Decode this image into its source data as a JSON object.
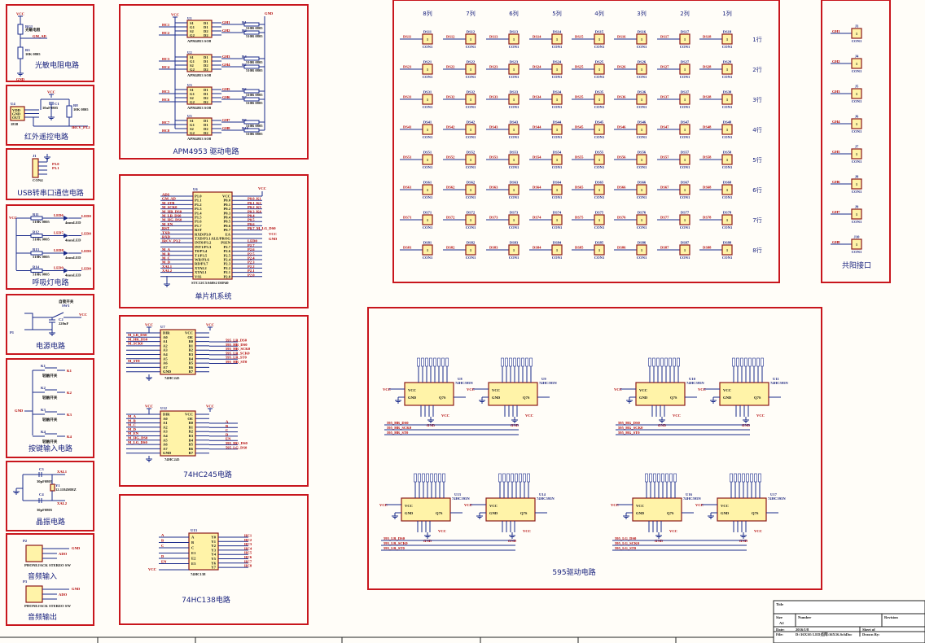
{
  "colors": {
    "panel": "#c8161d",
    "wire": "#1a2a8a",
    "chip_fill": "#fff3a8",
    "chip_border": "#8b1a1a",
    "net_label": "#b00000"
  },
  "sections": {
    "photo": "光敏电阻电路",
    "ir": "红外遥控电路",
    "usb": "USB转串口通信电路",
    "breath": "呼吸灯电路",
    "power": "电源电路",
    "keys": "按键输入电路",
    "crystal": "晶振电路",
    "audio_in": "音频输入",
    "audio_out": "音频输出",
    "apm": "APM4953 驱动电路",
    "mcu": "单片机系统",
    "hc245": "74HC245电路",
    "hc138": "74HC138电路",
    "matrix": "",
    "anode": "共阳接口",
    "hc595": "595驱动电路"
  },
  "photo": {
    "vcc": "VCC",
    "rg": "RG1",
    "rg_desc": "光敏电阻",
    "net": "GM_AD",
    "r": "R3",
    "r_val": "10K 0805",
    "gnd": "GND"
  },
  "ir": {
    "vcc": "VCC",
    "u": "U4",
    "pins": [
      "VDD",
      "GND",
      "OUT"
    ],
    "part": "1838",
    "c": "C1",
    "c_val": "10uF0805",
    "r": "R8",
    "r_val": "10K 0805",
    "net": "IRCV_P3.2"
  },
  "usb": {
    "j": "J1",
    "nets": [
      "P3.0",
      "P3.1"
    ],
    "gnd": "GND",
    "part": "CON4"
  },
  "breath": {
    "vcc": "VCC",
    "rows": [
      {
        "r": "R11",
        "val": "510K 0805",
        "led": "LED6",
        "net": "LED0",
        "type": "4mmLED"
      },
      {
        "r": "R12",
        "val": "510K 0805",
        "led": "LED7",
        "net": "LED0",
        "type": "4mmLED"
      },
      {
        "r": "R13",
        "val": "510K 0805",
        "led": "LED8",
        "net": "LED0",
        "type": "4mmLED"
      },
      {
        "r": "R14",
        "val": "510K 0805",
        "led": "LED9",
        "net": "LED0",
        "type": "4mmLED"
      }
    ]
  },
  "power": {
    "p": "P1",
    "sw": "SW1",
    "sw_desc": "自锁开关",
    "c": "C2",
    "c_val": "220uF",
    "vcc": "VCC"
  },
  "keys": {
    "gnd": "GND",
    "items": [
      {
        "k": "K1",
        "desc": "轻触开关",
        "net": "K1"
      },
      {
        "k": "K2",
        "desc": "轻触开关",
        "net": "K2"
      },
      {
        "k": "K3",
        "desc": "轻触开关",
        "net": "K3"
      },
      {
        "k": "K4",
        "desc": "轻触开关",
        "net": "K4"
      }
    ]
  },
  "crystal": {
    "c3": "C3",
    "c3_val": "30pF0805",
    "c4": "C4",
    "c4_val": "30pF0805",
    "y": "Y1",
    "y_val": "12.1184MHZ",
    "n1": "XAL1",
    "n2": "XAL2"
  },
  "audio": {
    "p2": "P2",
    "p3": "P3",
    "part": "PHONEJACK STEREO SW",
    "net": "ADO",
    "gnd": "GND"
  },
  "apm": {
    "vcc": "VCC",
    "gnd": "GND",
    "part": "APM4953 SO8",
    "res_val": "510R 0805",
    "pins_l": [
      "S1",
      "G1",
      "S2",
      "G2"
    ],
    "pins_r": [
      "D1",
      "D1",
      "D2",
      "D2"
    ],
    "chips": [
      {
        "ref": "U1",
        "in": [
          "HC1",
          "HC2"
        ],
        "out": [
          "GH1",
          "GH2"
        ],
        "r": [
          "R1",
          "R2"
        ]
      },
      {
        "ref": "U2",
        "in": [
          "HC3",
          "HC4"
        ],
        "out": [
          "GH3",
          "GH4"
        ],
        "r": [
          "R4",
          "R5"
        ]
      },
      {
        "ref": "U3",
        "in": [
          "HC5",
          "HC6"
        ],
        "out": [
          "GH5",
          "GH6"
        ],
        "r": [
          "R6",
          "R7"
        ]
      },
      {
        "ref": "U5",
        "in": [
          "HC7",
          "HC8"
        ],
        "out": [
          "GH7",
          "GH8"
        ],
        "r": [
          "R9",
          "R10"
        ]
      }
    ]
  },
  "mcu": {
    "ref": "U6",
    "part": "STC12C5A60S2 DIP40",
    "vcc": "VCC",
    "gnd": "GND",
    "left_pins": [
      "P1.0",
      "P1.1",
      "P1.2",
      "P1.3",
      "P1.4",
      "P1.5",
      "P1.6",
      "P1.7",
      "RST",
      "RXD/P3.0",
      "TXD/P3.1",
      "INT0/P3.2",
      "INT1/P3.3",
      "T0/P3.4",
      "T1/P3.5",
      "WR/P3.6",
      "RD/P3.7",
      "XTAL2",
      "XTAL1",
      "VSS"
    ],
    "left_nets": [
      "ADS",
      "GM_AD",
      "M_STB",
      "M_SCK0",
      "M_HR_DS0",
      "M_LR_DS0",
      "M_HG_DS0",
      "M_EN",
      "RST",
      "TXD",
      "RXD",
      "IRCV_P3.2",
      "",
      "M_A",
      "M_B",
      "M_C",
      "M_D",
      "XAL1",
      "XAL2",
      ""
    ],
    "right_pins": [
      "VCC",
      "P0.0",
      "P0.1",
      "P0.2",
      "P0.3",
      "P0.4",
      "P0.5",
      "P0.6",
      "P0.7",
      "EA",
      "ALE/PROG",
      "PSEN",
      "P2.7",
      "P2.6",
      "P2.5",
      "P2.4",
      "P2.3",
      "P2.2",
      "P2.1",
      "P2.0"
    ],
    "right_nets": [
      "",
      "P0.0_K1",
      "P0.1_K2",
      "P0.2_K3",
      "P0.3_K4",
      "P0.4",
      "P0.5",
      "P0.6",
      "P0.7_M_LG_DS0",
      "",
      "",
      "LED0",
      "P2.7",
      "P2.6",
      "P2.5",
      "P2.4",
      "P2.3",
      "P2.2",
      "P2.1",
      "P2.0"
    ]
  },
  "hc245": {
    "part": "74HC245",
    "vcc": "VCC",
    "chips": [
      {
        "ref": "U7",
        "left": [
          "DIR",
          "A0",
          "A1",
          "A2",
          "A3",
          "A4",
          "A5",
          "A6",
          "A7",
          "GND"
        ],
        "right": [
          "VCC",
          "OE",
          "B0",
          "B1",
          "B2",
          "B3",
          "B4",
          "B5",
          "B6",
          "B7"
        ],
        "in": [
          "M_LR_DS0",
          "M_HR_DS0",
          "M_SCK0",
          "",
          "",
          "",
          "M_ST0"
        ],
        "out": [
          "595_LR_DS0",
          "595_HR_DS0",
          "595_HR_SCK0",
          "595_LR_SCK0",
          "595_LR_ST0",
          "595_HR_ST0"
        ]
      },
      {
        "ref": "U12",
        "left": [
          "DIR",
          "A0",
          "A1",
          "A2",
          "A3",
          "A4",
          "A5",
          "A6",
          "A7",
          "GND"
        ],
        "right": [
          "VCC",
          "OE",
          "B0",
          "B1",
          "B2",
          "B3",
          "B4",
          "B5",
          "B6",
          "B7"
        ],
        "in": [
          "M_A",
          "M_B",
          "M_C",
          "M_D",
          "M_EN",
          "M_HG_DS0",
          "M_LG_DS0"
        ],
        "out": [
          "A",
          "B",
          "C",
          "D",
          "EN",
          "595_HG_DS0",
          "595_LG_DS0"
        ]
      }
    ]
  },
  "hc138": {
    "ref": "U13",
    "part": "74HC138",
    "vcc": "VCC",
    "left": [
      "A",
      "B",
      "C",
      "E1",
      "E2",
      "E3"
    ],
    "right": [
      "Y0",
      "Y1",
      "Y2",
      "Y3",
      "Y4",
      "Y5",
      "Y6",
      "Y7"
    ],
    "in": [
      "A",
      "B",
      "C",
      "D",
      "EN"
    ],
    "out": [
      "HC1",
      "HC2",
      "HC3",
      "HC4",
      "HC5",
      "HC6",
      "HC7",
      "HC8"
    ]
  },
  "matrix": {
    "columns": [
      "8列",
      "7列",
      "6列",
      "5列",
      "4列",
      "3列",
      "2列",
      "1列"
    ],
    "rows": [
      "1行",
      "2行",
      "3行",
      "4行",
      "5行",
      "6行",
      "7行",
      "8行"
    ],
    "pin": "1",
    "part": "CON1",
    "prefix": "DS"
  },
  "anode": {
    "nets": [
      "GH1",
      "GH2",
      "GH3",
      "GH4",
      "GH5",
      "GH6",
      "GH7",
      "GH8"
    ],
    "refs": [
      "J3",
      "J4",
      "J5",
      "J6",
      "J7",
      "J8",
      "J9",
      "J10"
    ],
    "pin": "1",
    "part": "CON1"
  },
  "hc595": {
    "part": "74HC595N",
    "vcc": "VCC",
    "gnd": "GND",
    "pins_l": [
      "VCC",
      "GND"
    ],
    "pin_r": "Q7S",
    "chips": [
      "U8",
      "U9",
      "U10",
      "U11",
      "U13",
      "U14",
      "U16",
      "U17"
    ],
    "nets": [
      [
        "595_HR_DS0",
        "595_HR_SCK0",
        "595_HR_ST0"
      ],
      [
        "595_HG_DS0",
        "595_HG_SCK0",
        "595_HG_ST0"
      ],
      [
        "595_LR_DS0",
        "595_LR_SCK0",
        "595_LR_ST0"
      ],
      [
        "595_LG_DS0",
        "595_LG_SCK0",
        "595_LG_ST0"
      ]
    ]
  },
  "titleblock": {
    "title": "Title",
    "size_label": "Size",
    "size": "A2",
    "number_label": "Number",
    "revision_label": "Revision",
    "date_label": "Date:",
    "date": "2016/1/8",
    "file_label": "File:",
    "file": "D:\\16X16\\ LED点阵\\16X16.SchDoc",
    "sheet": "Sheet  of",
    "drawn": "Drawn By:"
  }
}
